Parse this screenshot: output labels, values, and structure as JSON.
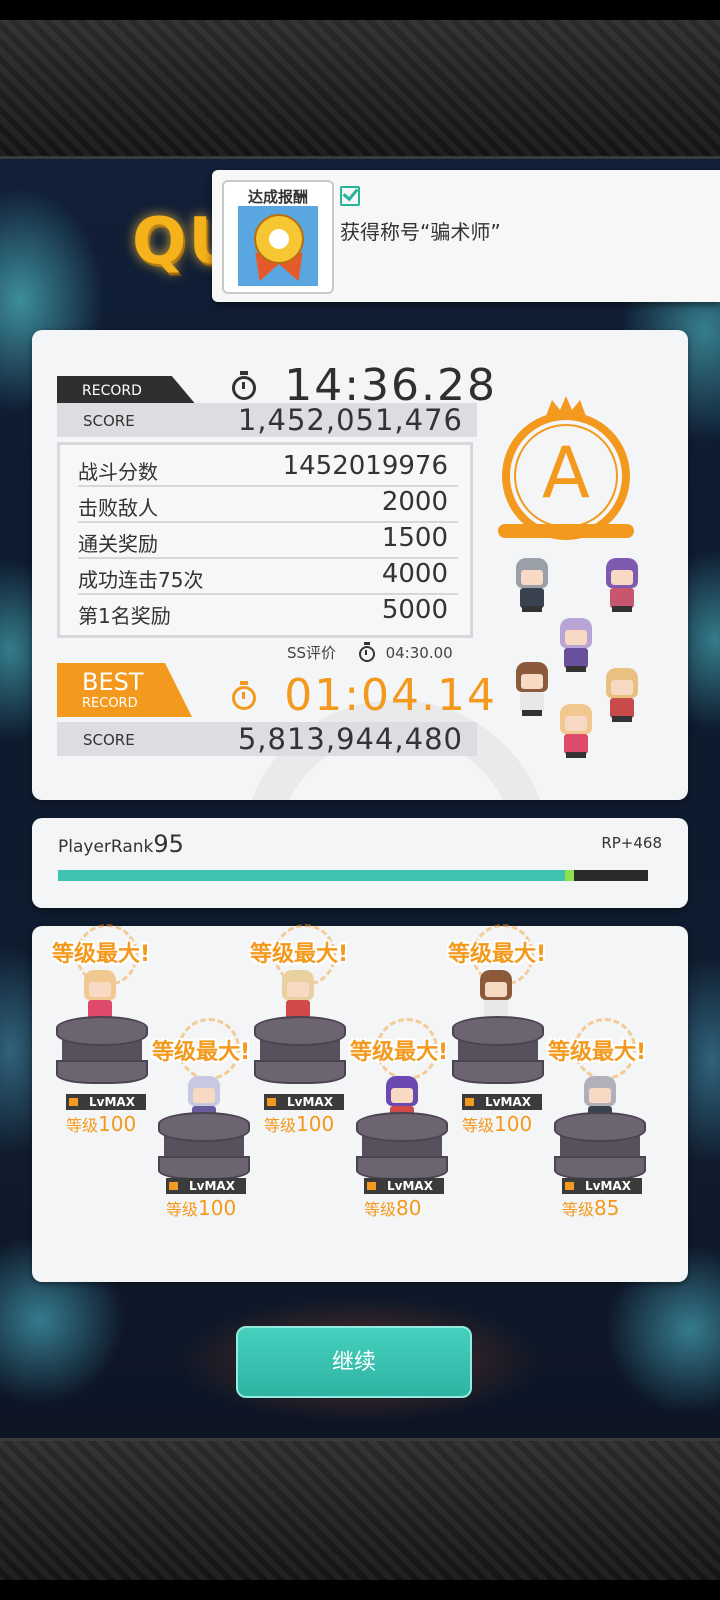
{
  "quest_title_partial": "QU",
  "notification": {
    "badge_label": "达成报酬",
    "message": "获得称号“骗术师”"
  },
  "record": {
    "tag": "RECORD",
    "time": "14:36.28",
    "score_label": "SCORE",
    "score": "1,452,051,476",
    "breakdown": [
      {
        "label": "战斗分数",
        "value": "1452019976"
      },
      {
        "label": "击败敌人",
        "value": "2000"
      },
      {
        "label": "通关奖励",
        "value": "1500"
      },
      {
        "label": "成功连击75次",
        "value": "4000"
      },
      {
        "label": "第1名奖励",
        "value": "5000"
      }
    ],
    "grade": "A"
  },
  "best": {
    "tag_main": "BEST",
    "tag_sub": "RECORD",
    "ss_label": "SS评价",
    "ss_time": "04:30.00",
    "time": "01:04.14",
    "score_label": "SCORE",
    "score": "5,813,944,480"
  },
  "player_rank": {
    "label": "PlayerRank",
    "rank": "95",
    "rp": "RP+468",
    "progress_fraction": 0.86,
    "gain_fraction": 0.016
  },
  "characters": [
    {
      "max_label": "等级最大!",
      "lv_badge": "LvMAX",
      "lv_key": "等级",
      "lv": "100"
    },
    {
      "max_label": "等级最大!",
      "lv_badge": "LvMAX",
      "lv_key": "等级",
      "lv": "100"
    },
    {
      "max_label": "等级最大!",
      "lv_badge": "LvMAX",
      "lv_key": "等级",
      "lv": "100"
    },
    {
      "max_label": "等级最大!",
      "lv_badge": "LvMAX",
      "lv_key": "等级",
      "lv": "100"
    },
    {
      "max_label": "等级最大!",
      "lv_badge": "LvMAX",
      "lv_key": "等级",
      "lv": "80"
    },
    {
      "max_label": "等级最大!",
      "lv_badge": "LvMAX",
      "lv_key": "等级",
      "lv": "85"
    }
  ],
  "continue_label": "继续",
  "colors": {
    "accent": "#f39a1e",
    "teal": "#3fc2b0",
    "dark": "#2f2f2f"
  }
}
